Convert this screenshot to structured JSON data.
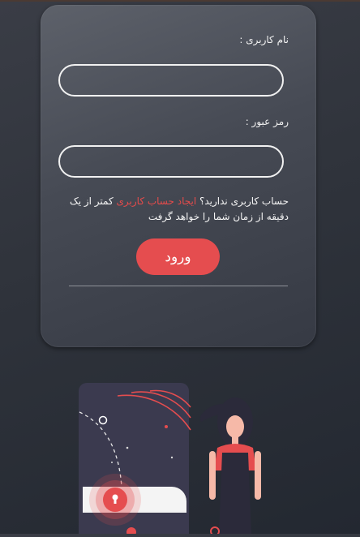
{
  "form": {
    "username_label": "نام کاربری :",
    "password_label": "رمز عبور :",
    "username_value": "",
    "password_value": "",
    "signup_prefix": "حساب کاربری ندارید؟",
    "signup_link": "ایجاد حساب کاربری",
    "signup_suffix": "کمتر از یک دقیقه از زمان شما را خواهد گرفت",
    "login_button": "ورود"
  },
  "colors": {
    "accent": "#e54d4f",
    "link": "#e54b4b",
    "card_top": "#5d616a",
    "card_bottom": "#363a44"
  },
  "illustration": {
    "icon": "phone-lock-woman-illustration"
  }
}
